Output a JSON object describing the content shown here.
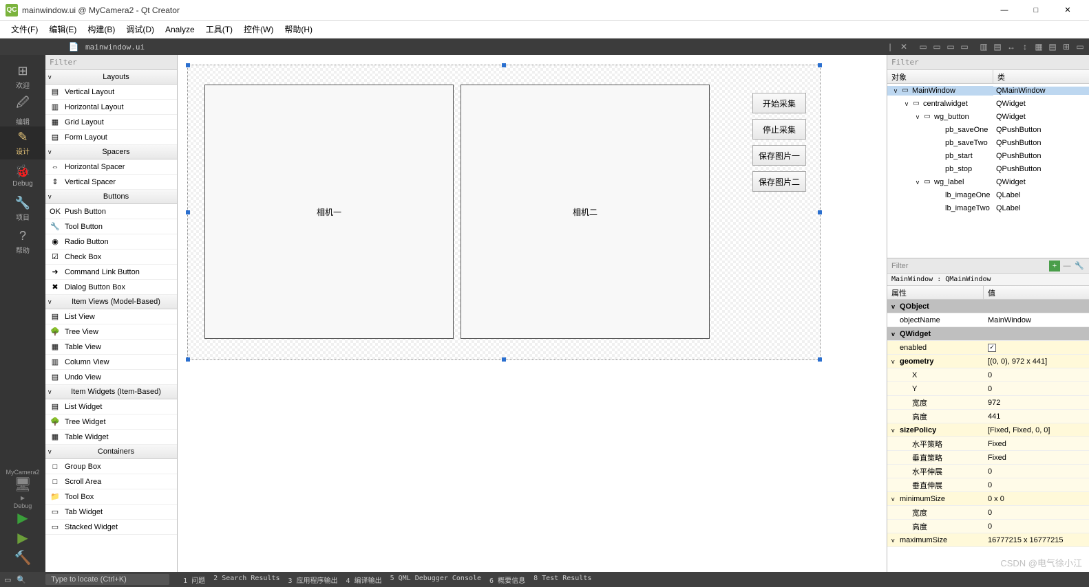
{
  "window": {
    "title": "mainwindow.ui @ MyCamera2 - Qt Creator",
    "logo": "QC"
  },
  "winbtns": {
    "min": "—",
    "max": "□",
    "close": "✕"
  },
  "menu": [
    "文件(F)",
    "编辑(E)",
    "构建(B)",
    "调试(D)",
    "Analyze",
    "工具(T)",
    "控件(W)",
    "帮助(H)"
  ],
  "tabrow": {
    "filename": "mainwindow.ui"
  },
  "modes": [
    {
      "icon": "⊞",
      "label": "欢迎"
    },
    {
      "icon": "🖉",
      "label": "编辑"
    },
    {
      "icon": "✎",
      "label": "设计",
      "active": true
    },
    {
      "icon": "🐞",
      "label": "Debug"
    },
    {
      "icon": "🔧",
      "label": "项目"
    },
    {
      "icon": "?",
      "label": "帮助"
    }
  ],
  "project": {
    "name": "MyCamera2",
    "debug": "Debug"
  },
  "runcontrols": {
    "run": "▶",
    "rundbg": "▶",
    "build": "🔨"
  },
  "widgetbox": {
    "filter_placeholder": "Filter",
    "groups": [
      {
        "name": "Layouts",
        "items": [
          {
            "icon": "▤",
            "label": "Vertical Layout"
          },
          {
            "icon": "▥",
            "label": "Horizontal Layout"
          },
          {
            "icon": "▦",
            "label": "Grid Layout"
          },
          {
            "icon": "▤",
            "label": "Form Layout"
          }
        ]
      },
      {
        "name": "Spacers",
        "items": [
          {
            "icon": "⇔",
            "label": "Horizontal Spacer"
          },
          {
            "icon": "⇕",
            "label": "Vertical Spacer"
          }
        ]
      },
      {
        "name": "Buttons",
        "items": [
          {
            "icon": "OK",
            "label": "Push Button"
          },
          {
            "icon": "🔧",
            "label": "Tool Button"
          },
          {
            "icon": "◉",
            "label": "Radio Button"
          },
          {
            "icon": "☑",
            "label": "Check Box"
          },
          {
            "icon": "➜",
            "label": "Command Link Button"
          },
          {
            "icon": "✖",
            "label": "Dialog Button Box"
          }
        ]
      },
      {
        "name": "Item Views (Model-Based)",
        "items": [
          {
            "icon": "▤",
            "label": "List View"
          },
          {
            "icon": "🌳",
            "label": "Tree View"
          },
          {
            "icon": "▦",
            "label": "Table View"
          },
          {
            "icon": "▥",
            "label": "Column View"
          },
          {
            "icon": "▤",
            "label": "Undo View"
          }
        ]
      },
      {
        "name": "Item Widgets (Item-Based)",
        "items": [
          {
            "icon": "▤",
            "label": "List Widget"
          },
          {
            "icon": "🌳",
            "label": "Tree Widget"
          },
          {
            "icon": "▦",
            "label": "Table Widget"
          }
        ]
      },
      {
        "name": "Containers",
        "items": [
          {
            "icon": "□",
            "label": "Group Box"
          },
          {
            "icon": "□",
            "label": "Scroll Area"
          },
          {
            "icon": "📁",
            "label": "Tool Box"
          },
          {
            "icon": "▭",
            "label": "Tab Widget"
          },
          {
            "icon": "▭",
            "label": "Stacked Widget"
          }
        ]
      }
    ]
  },
  "design": {
    "camera1": "相机一",
    "camera2": "相机二",
    "btns": [
      "开始采集",
      "停止采集",
      "保存图片一",
      "保存图片二"
    ]
  },
  "objecttree": {
    "filter_placeholder": "Filter",
    "hdr1": "对象",
    "hdr2": "类",
    "rows": [
      {
        "d": 0,
        "exp": "v",
        "icon": "▭",
        "name": "MainWindow",
        "cls": "QMainWindow",
        "sel": true
      },
      {
        "d": 1,
        "exp": "v",
        "icon": "▭",
        "name": "centralwidget",
        "cls": "QWidget"
      },
      {
        "d": 2,
        "exp": "v",
        "icon": "▭",
        "name": "wg_button",
        "cls": "QWidget"
      },
      {
        "d": 3,
        "exp": "",
        "icon": "",
        "name": "pb_saveOne",
        "cls": "QPushButton"
      },
      {
        "d": 3,
        "exp": "",
        "icon": "",
        "name": "pb_saveTwo",
        "cls": "QPushButton"
      },
      {
        "d": 3,
        "exp": "",
        "icon": "",
        "name": "pb_start",
        "cls": "QPushButton"
      },
      {
        "d": 3,
        "exp": "",
        "icon": "",
        "name": "pb_stop",
        "cls": "QPushButton"
      },
      {
        "d": 2,
        "exp": "v",
        "icon": "▭",
        "name": "wg_label",
        "cls": "QWidget"
      },
      {
        "d": 3,
        "exp": "",
        "icon": "",
        "name": "lb_imageOne",
        "cls": "QLabel"
      },
      {
        "d": 3,
        "exp": "",
        "icon": "",
        "name": "lb_imageTwo",
        "cls": "QLabel"
      }
    ]
  },
  "props": {
    "filter_placeholder": "Filter",
    "crumb": "MainWindow : QMainWindow",
    "hdr1": "属性",
    "hdr2": "值",
    "rows": [
      {
        "type": "section",
        "chev": "v",
        "name": "QObject"
      },
      {
        "type": "plain",
        "name": "objectName",
        "value": "MainWindow"
      },
      {
        "type": "section",
        "chev": "v",
        "name": "QWidget"
      },
      {
        "type": "y1",
        "name": "enabled",
        "value": "check"
      },
      {
        "type": "y1",
        "chev": "v",
        "bold": true,
        "name": "geometry",
        "value": "[(0, 0), 972 x 441]"
      },
      {
        "type": "y2",
        "indent": 1,
        "name": "X",
        "value": "0"
      },
      {
        "type": "y2",
        "indent": 1,
        "name": "Y",
        "value": "0"
      },
      {
        "type": "y2",
        "indent": 1,
        "name": "宽度",
        "value": "972"
      },
      {
        "type": "y2",
        "indent": 1,
        "name": "高度",
        "value": "441"
      },
      {
        "type": "y1",
        "chev": "v",
        "bold": true,
        "name": "sizePolicy",
        "value": "[Fixed, Fixed, 0, 0]"
      },
      {
        "type": "y2",
        "indent": 1,
        "name": "水平策略",
        "value": "Fixed"
      },
      {
        "type": "y2",
        "indent": 1,
        "name": "垂直策略",
        "value": "Fixed"
      },
      {
        "type": "y2",
        "indent": 1,
        "name": "水平伸展",
        "value": "0"
      },
      {
        "type": "y2",
        "indent": 1,
        "name": "垂直伸展",
        "value": "0"
      },
      {
        "type": "y1",
        "chev": "v",
        "name": "minimumSize",
        "value": "0 x 0"
      },
      {
        "type": "y2",
        "indent": 1,
        "name": "宽度",
        "value": "0"
      },
      {
        "type": "y2",
        "indent": 1,
        "name": "高度",
        "value": "0"
      },
      {
        "type": "y1",
        "chev": "v",
        "name": "maximumSize",
        "value": "16777215 x 16777215"
      }
    ]
  },
  "status": {
    "locate": "Type to locate (Ctrl+K)",
    "panes": [
      "1 问题",
      "2 Search Results",
      "3 应用程序输出",
      "4 编译输出",
      "5 QML Debugger Console",
      "6 概要信息",
      "8 Test Results"
    ]
  },
  "watermark": "CSDN @电气徐小江"
}
